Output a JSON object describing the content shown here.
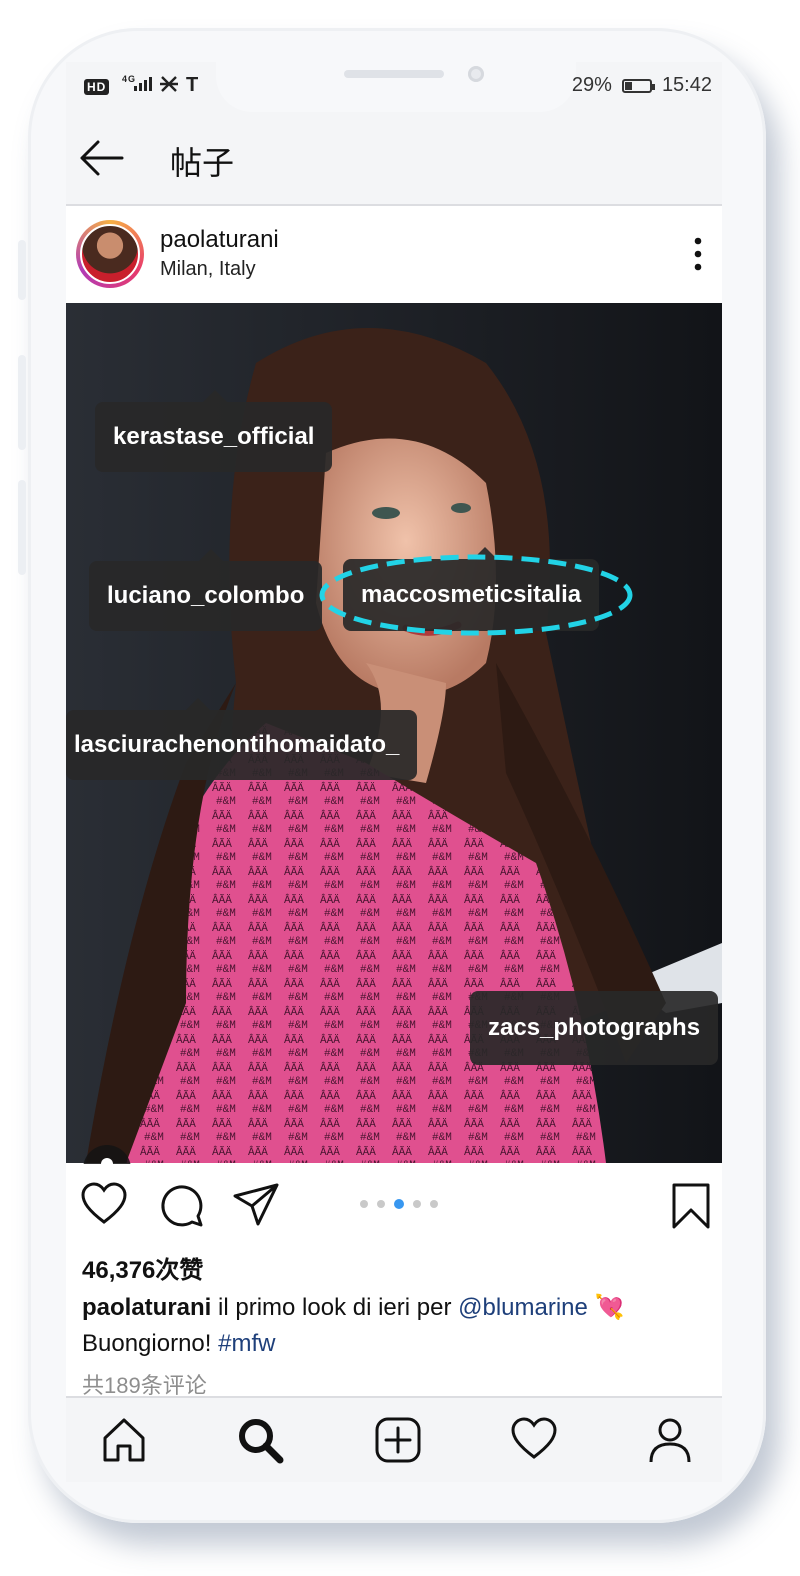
{
  "status_bar": {
    "left": "HD 4G ⁢ıl ⛌ T",
    "battery": "29%",
    "battery_level": 0.29,
    "time": "15:42"
  },
  "header": {
    "title": "帖子",
    "back_icon": "arrow-left-icon"
  },
  "post": {
    "username": "paolaturani",
    "location": "Milan, Italy",
    "more_icon": "more-vertical-icon",
    "tags": [
      "kerastase_official",
      "luciano_colombo",
      "maccosmeticsitalia",
      "lasciurachenontihomaidato_",
      "zacs_photographs"
    ],
    "highlight_color": "#22d3e6",
    "carousel": {
      "total": 5,
      "active": 3
    },
    "likes": "46,376次赞",
    "caption": {
      "username": "paolaturani",
      "text": " il primo look di ieri per ",
      "mention": "@blumarine",
      "emoji": " 💘",
      "line2": "Buongiorno! ",
      "hashtag": "#mfw"
    },
    "comments_link": "共189条评论"
  },
  "nav": [
    "home-icon",
    "search-icon",
    "add-post-icon",
    "activity-heart-icon",
    "profile-icon"
  ]
}
